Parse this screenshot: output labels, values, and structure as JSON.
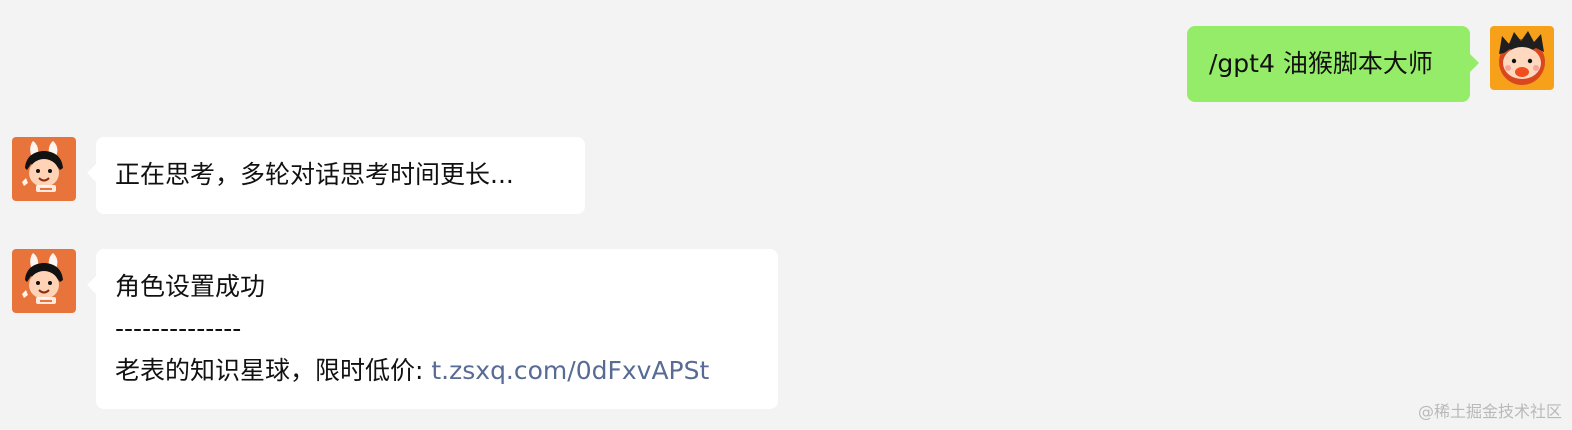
{
  "messages": [
    {
      "role": "user",
      "text": "/gpt4 油猴脚本大师"
    },
    {
      "role": "bot",
      "text": "正在思考，多轮对话思考时间更长..."
    },
    {
      "role": "bot",
      "line1": "角色设置成功",
      "line2": "--------------",
      "line3_prefix": "老表的知识星球，限时低价: ",
      "line3_link": "t.zsxq.com/0dFxvAPSt"
    }
  ],
  "watermark": "@稀土掘金技术社区",
  "colors": {
    "background": "#f3f3f3",
    "user_bubble": "#95ec69",
    "bot_bubble": "#ffffff",
    "link": "#576b95",
    "user_avatar_bg": "#f7a11b",
    "bot_avatar_bg": "#e8743b"
  },
  "icons": {
    "user_avatar": "cartoon-boy-avatar-icon",
    "bot_avatar": "bunny-ear-kid-avatar-icon"
  }
}
